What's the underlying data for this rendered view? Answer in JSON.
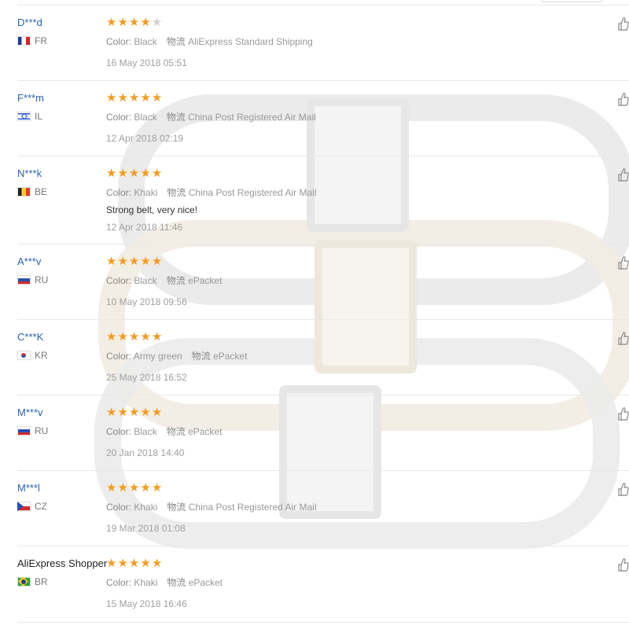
{
  "labels": {
    "color_key": "Color:",
    "shipping_key": "物流"
  },
  "reviews": [
    {
      "user": "D***d",
      "country": "FR",
      "stars": 4,
      "color": "Black",
      "shipping": "AliExpress Standard Shipping",
      "comment": "",
      "date": "16 May 2018 05:51"
    },
    {
      "user": "F***m",
      "country": "IL",
      "stars": 5,
      "color": "Black",
      "shipping": "China Post Registered Air Mail",
      "comment": "",
      "date": "12 Apr 2018 02:19"
    },
    {
      "user": "N***k",
      "country": "BE",
      "stars": 5,
      "color": "Khaki",
      "shipping": "China Post Registered Air Mail",
      "comment": "Strong belt, very nice!",
      "date": "12 Apr 2018 11:46"
    },
    {
      "user": "A***v",
      "country": "RU",
      "stars": 5,
      "color": "Black",
      "shipping": "ePacket",
      "comment": "",
      "date": "10 May 2018 09:56"
    },
    {
      "user": "C***K",
      "country": "KR",
      "stars": 5,
      "color": "Army green",
      "shipping": "ePacket",
      "comment": "",
      "date": "25 May 2018 16:52"
    },
    {
      "user": "M***v",
      "country": "RU",
      "stars": 5,
      "color": "Black",
      "shipping": "ePacket",
      "comment": "",
      "date": "20 Jan 2018 14:40"
    },
    {
      "user": "M***l",
      "country": "CZ",
      "stars": 5,
      "color": "Khaki",
      "shipping": "China Post Registered Air Mail",
      "comment": "",
      "date": "19 Mar 2018 01:08"
    },
    {
      "user": "AliExpress Shopper",
      "country": "BR",
      "stars": 5,
      "color": "Khaki",
      "shipping": "ePacket",
      "comment": "",
      "date": "15 May 2018 16:46"
    }
  ],
  "colors": {
    "username": "#2a63b3",
    "star_on": "#f59b1f",
    "star_off": "#d2d2d2"
  },
  "icons": {
    "like": "thumbs-up-icon",
    "star": "star-icon",
    "flag": "country-flag-icon"
  }
}
